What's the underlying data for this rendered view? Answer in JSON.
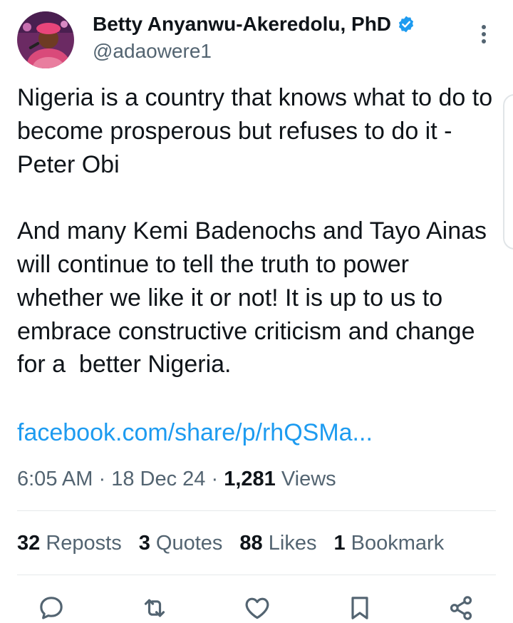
{
  "author": {
    "display_name": "Betty Anyanwu-Akeredolu, PhD",
    "handle": "@adaowere1",
    "verified": true
  },
  "tweet": {
    "paragraph1": "Nigeria is a country that knows what to do to become prosperous but refuses to do it - Peter Obi",
    "paragraph2": "And many Kemi Badenochs and Tayo Ainas will continue to tell the truth to power whether we like it or not! It is up to us to embrace constructive criticism and change for a  better Nigeria.",
    "link": "facebook.com/share/p/rhQSMa..."
  },
  "meta": {
    "time": "6:05 AM",
    "date": "18 Dec 24",
    "separator": "·",
    "views_count": "1,281",
    "views_label": "Views"
  },
  "stats": {
    "reposts_count": "32",
    "reposts_label": "Reposts",
    "quotes_count": "3",
    "quotes_label": "Quotes",
    "likes_count": "88",
    "likes_label": "Likes",
    "bookmarks_count": "1",
    "bookmarks_label": "Bookmark"
  },
  "actions": [
    "reply-icon",
    "repost-icon",
    "like-icon",
    "bookmark-icon",
    "share-icon"
  ],
  "colors": {
    "text": "#0f1419",
    "secondary": "#536471",
    "link": "#1d9bf0",
    "verified": "#1d9bf0"
  }
}
